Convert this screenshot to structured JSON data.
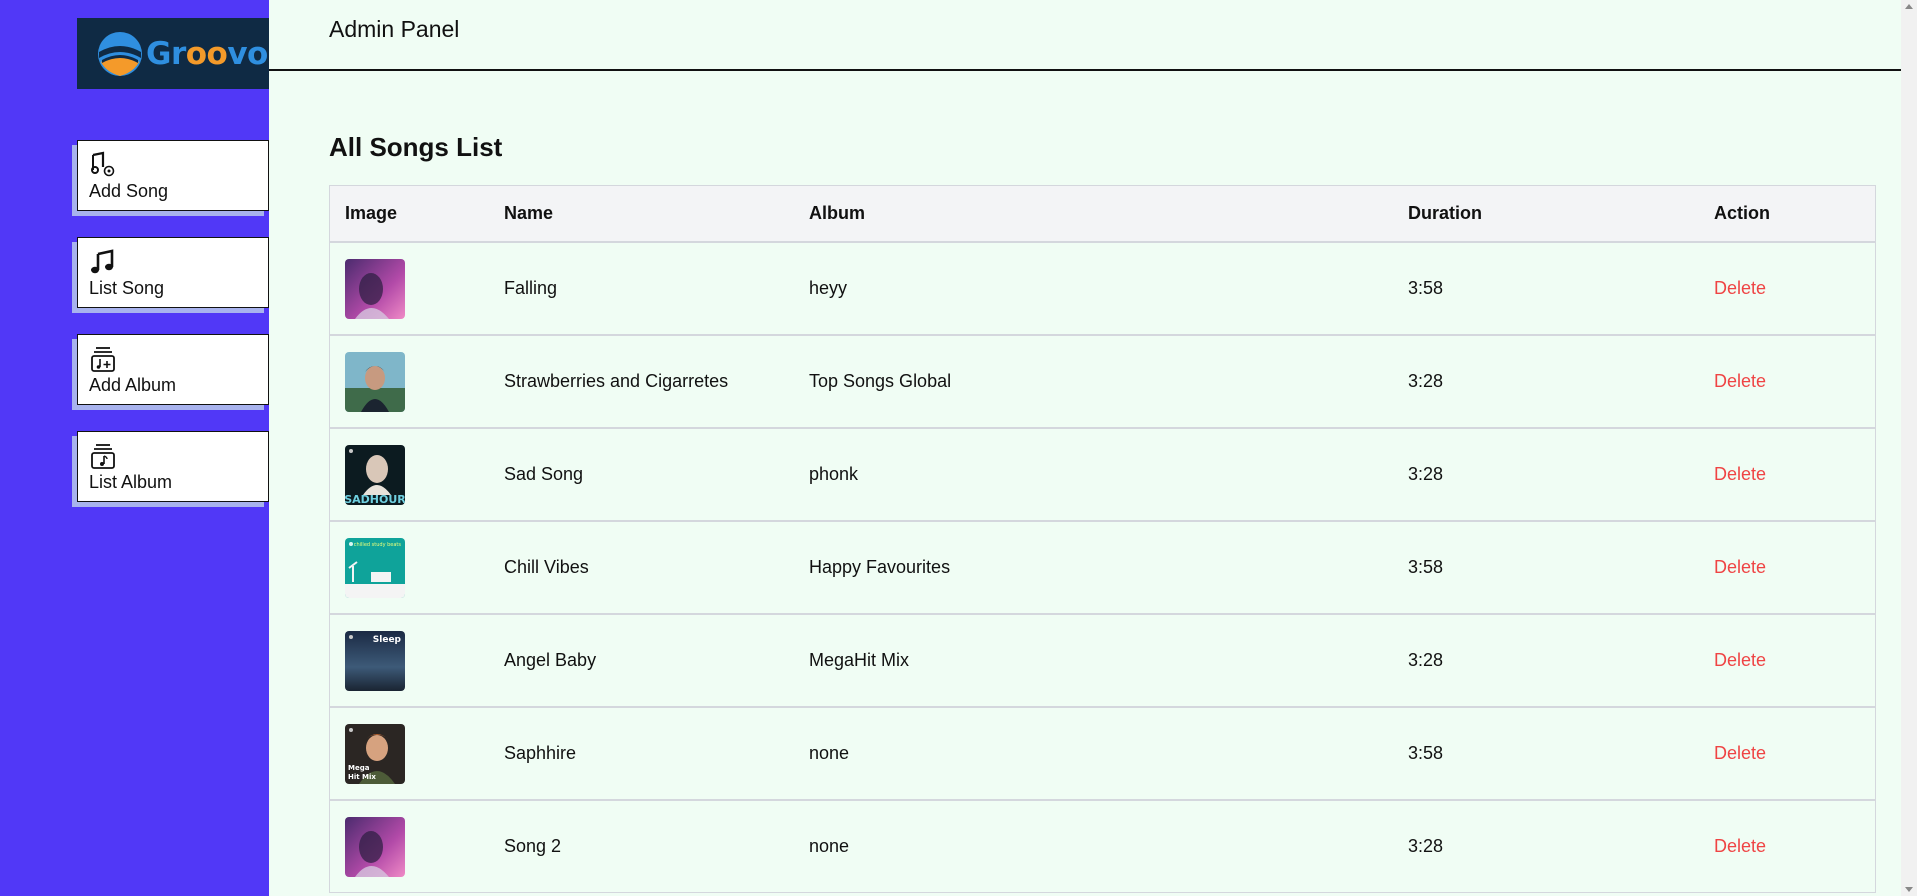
{
  "logo": {
    "text_part1": "Gr",
    "text_part2": "oo",
    "text_part3": "vo"
  },
  "sidebar": {
    "items": [
      {
        "label": "Add Song",
        "icon": "add-song-icon"
      },
      {
        "label": "List Song",
        "icon": "music-note-icon"
      },
      {
        "label": "Add Album",
        "icon": "add-album-icon"
      },
      {
        "label": "List Album",
        "icon": "album-icon"
      }
    ]
  },
  "header": {
    "title": "Admin Panel"
  },
  "main": {
    "title": "All Songs List",
    "columns": [
      "Image",
      "Name",
      "Album",
      "Duration",
      "Action"
    ],
    "rows": [
      {
        "name": "Falling",
        "album": "heyy",
        "duration": "3:58",
        "action": "Delete"
      },
      {
        "name": "Strawberries and Cigarretes",
        "album": "Top Songs Global",
        "duration": "3:28",
        "action": "Delete"
      },
      {
        "name": "Sad Song",
        "album": "phonk",
        "duration": "3:28",
        "action": "Delete"
      },
      {
        "name": "Chill Vibes",
        "album": "Happy Favourites",
        "duration": "3:58",
        "action": "Delete"
      },
      {
        "name": "Angel Baby",
        "album": "MegaHit Mix",
        "duration": "3:28",
        "action": "Delete"
      },
      {
        "name": "Saphhire",
        "album": "none",
        "duration": "3:58",
        "action": "Delete"
      },
      {
        "name": "Song 2",
        "album": "none",
        "duration": "3:28",
        "action": "Delete"
      }
    ]
  },
  "thumb_text": {
    "sad": "SADHOUR",
    "chill": "chilled\nstudy beats",
    "sleep": "Sleep",
    "mega": "Mega\nHit Mix"
  },
  "colors": {
    "sidebar": "#5138f7",
    "accent_delete": "#ef4444",
    "background": "#f0fdf4"
  }
}
